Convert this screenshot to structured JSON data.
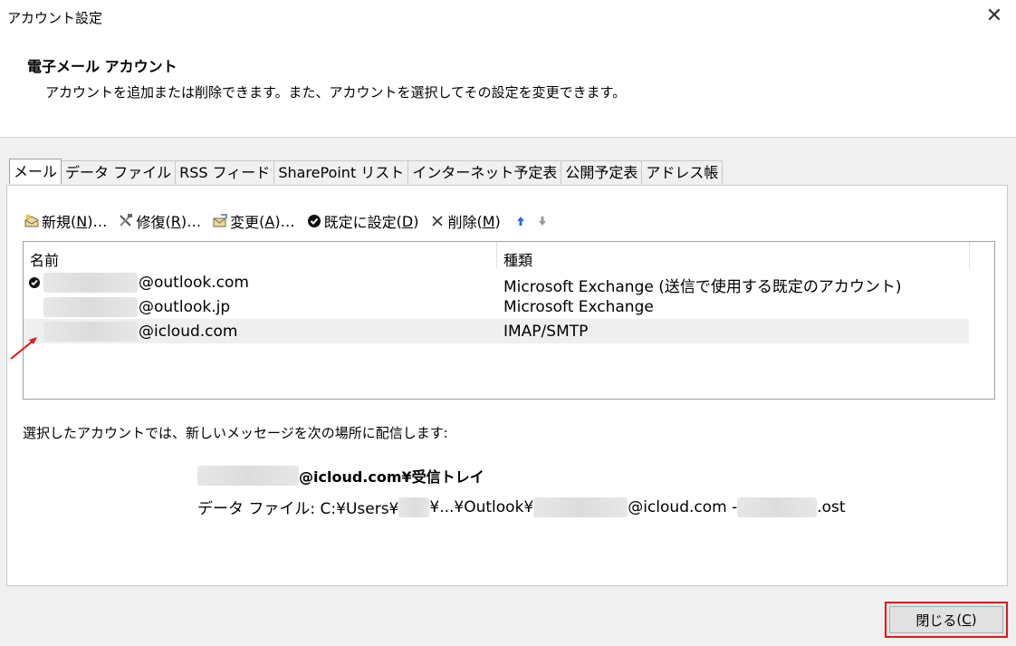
{
  "window": {
    "title": "アカウント設定",
    "close_glyph": "✕"
  },
  "header": {
    "title": "電子メール アカウント",
    "subtitle": "アカウントを追加または削除できます。また、アカウントを選択してその設定を変更できます。"
  },
  "tabs": [
    {
      "label": "メール",
      "active": true
    },
    {
      "label": "データ ファイル",
      "active": false
    },
    {
      "label": "RSS フィード",
      "active": false
    },
    {
      "label": "SharePoint リスト",
      "active": false
    },
    {
      "label": "インターネット予定表",
      "active": false
    },
    {
      "label": "公開予定表",
      "active": false
    },
    {
      "label": "アドレス帳",
      "active": false
    }
  ],
  "toolbar": {
    "new": {
      "label": "新規",
      "key": "N",
      "suffix": "…",
      "icon": "new-account-icon"
    },
    "repair": {
      "label": "修復",
      "key": "R",
      "suffix": "…",
      "icon": "repair-tools-icon"
    },
    "change": {
      "label": "変更",
      "key": "A",
      "suffix": "…",
      "icon": "change-account-icon"
    },
    "set_default": {
      "label": "既定に設定",
      "key": "D",
      "suffix": "",
      "icon": "checkmark-circle-icon"
    },
    "remove": {
      "label": "削除",
      "key": "M",
      "suffix": "",
      "icon": "x-icon"
    },
    "move_up_icon": "arrow-up-icon",
    "move_down_icon": "arrow-down-icon"
  },
  "list": {
    "columns": [
      "名前",
      "種類"
    ],
    "rows": [
      {
        "name": "@outlook.com",
        "type": "Microsoft Exchange (送信で使用する既定のアカウント)",
        "default": true,
        "selected": false
      },
      {
        "name": "@outlook.jp",
        "type": "Microsoft Exchange",
        "default": false,
        "selected": false
      },
      {
        "name": "@icloud.com",
        "type": "IMAP/SMTP",
        "default": false,
        "selected": true
      }
    ]
  },
  "delivery": {
    "label": "選択したアカウントでは、新しいメッセージを次の場所に配信します:",
    "target_suffix": "@icloud.com¥受信トレイ",
    "datafile_prefix": "データ ファイル: C:¥Users¥",
    "datafile_mid": "¥...¥Outlook¥",
    "datafile_account": "@icloud.com - ",
    "datafile_ext": ".ost"
  },
  "footer": {
    "close_label": "閉じる",
    "close_key": "C"
  },
  "colors": {
    "highlight_border": "#e0161a",
    "annotation_arrow": "#e0161a",
    "selected_row": "#efefef"
  }
}
